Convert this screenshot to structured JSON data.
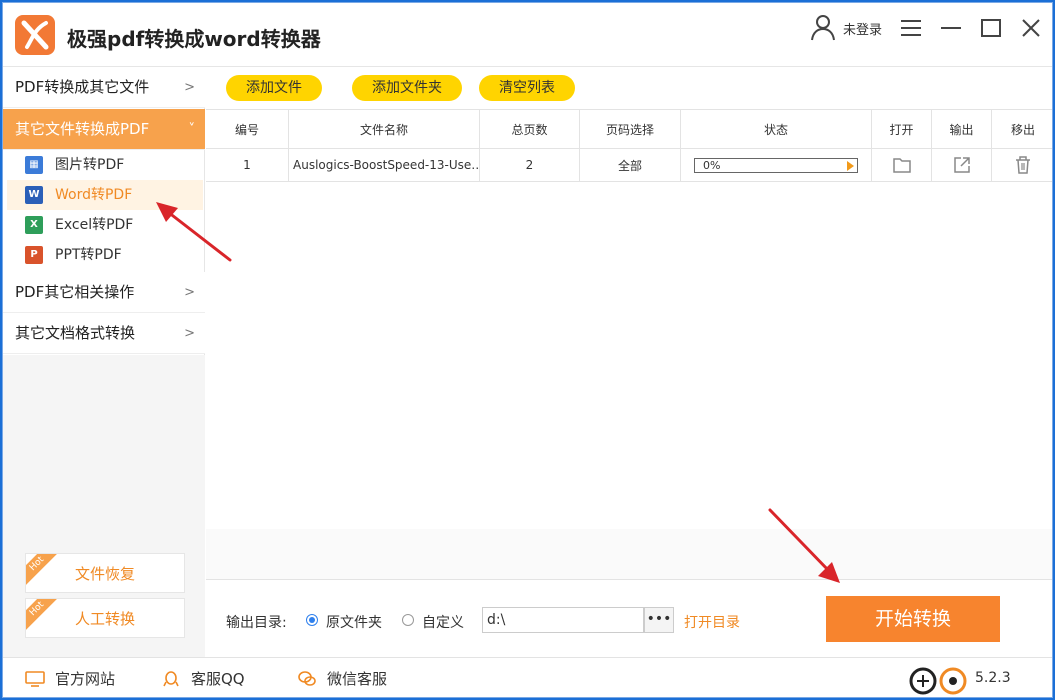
{
  "app": {
    "title": "极强pdf转换成word转换器",
    "login_status": "未登录"
  },
  "sidebar": {
    "categories": [
      {
        "label": "PDF转换成其它文件",
        "chevron": ">"
      },
      {
        "label": "其它文件转换成PDF",
        "chevron": "˅"
      },
      {
        "label": "PDF其它相关操作",
        "chevron": ">"
      },
      {
        "label": "其它文档格式转换",
        "chevron": ">"
      }
    ],
    "subitems": [
      {
        "label": "图片转PDF",
        "icon": "image-icon",
        "color": "#3b7bd8"
      },
      {
        "label": "Word转PDF",
        "icon": "word-icon",
        "color": "#2b5fb8"
      },
      {
        "label": "Excel转PDF",
        "icon": "excel-icon",
        "color": "#2e9e5a"
      },
      {
        "label": "PPT转PDF",
        "icon": "ppt-icon",
        "color": "#d9532b"
      }
    ],
    "promos": [
      {
        "label": "文件恢复",
        "badge": "Hot"
      },
      {
        "label": "人工转换",
        "badge": "Hot"
      }
    ]
  },
  "toolbar": {
    "add_file": "添加文件",
    "add_folder": "添加文件夹",
    "clear_list": "清空列表"
  },
  "table": {
    "headers": [
      "编号",
      "文件名称",
      "总页数",
      "页码选择",
      "状态",
      "打开",
      "输出",
      "移出"
    ],
    "rows": [
      {
        "index": "1",
        "filename": "Auslogics-BoostSpeed-13-Use…",
        "pages": "2",
        "page_select": "全部",
        "progress_text": "0%",
        "progress": 0
      }
    ]
  },
  "output": {
    "label": "输出目录:",
    "option_original": "原文件夹",
    "option_custom": "自定义",
    "path_value": "d:\\",
    "browse": "•••",
    "open_dir": "打开目录",
    "start": "开始转换"
  },
  "statusbar": {
    "website": "官方网站",
    "qq": "客服QQ",
    "wechat": "微信客服",
    "version": "5.2.3"
  },
  "colors": {
    "accent": "#f7a24c",
    "button_yellow": "#ffd400",
    "start_button": "#f7842e",
    "annotation_arrow": "#d9252a"
  }
}
